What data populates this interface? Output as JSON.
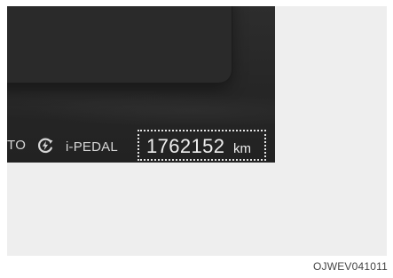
{
  "cluster": {
    "auto_text": "TO",
    "regen_icon": "regen-charge-icon",
    "pedal_label": "i-PEDAL",
    "odometer": {
      "value": "1762152",
      "unit": "km"
    }
  },
  "figure_code": "OJWEV041011",
  "colors": {
    "cluster_bg": "#262626",
    "cluster_text": "#d6d6d6",
    "page_bg": "#eeeeee"
  }
}
